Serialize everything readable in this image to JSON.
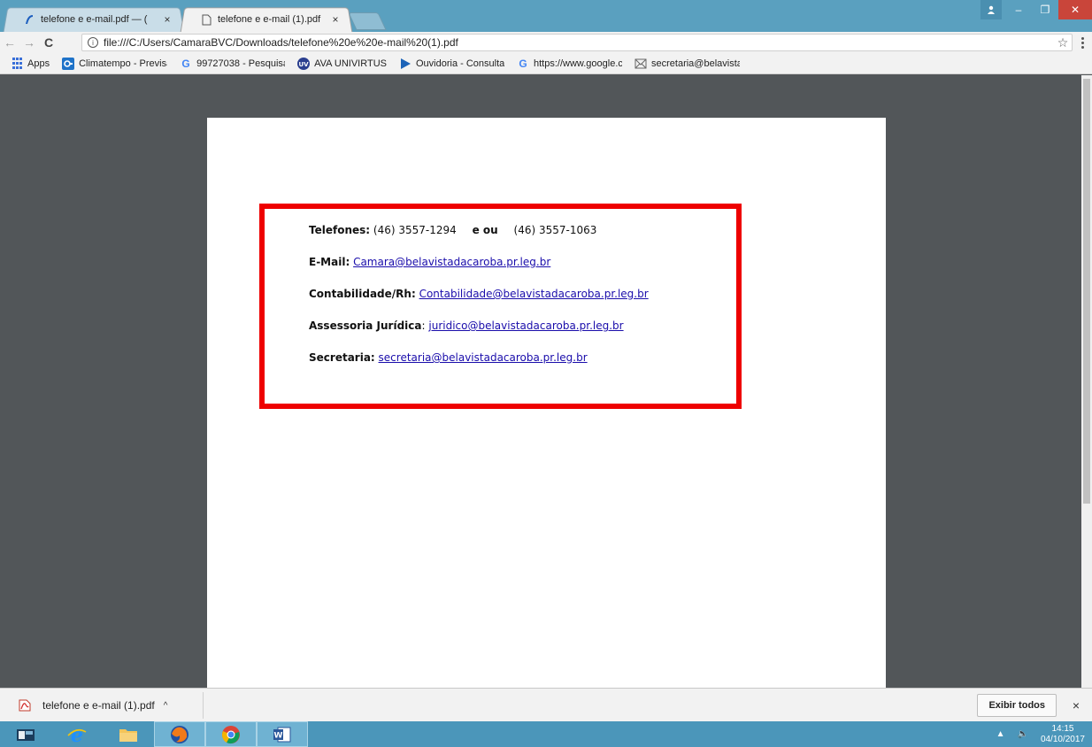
{
  "browser": {
    "tabs": [
      {
        "title": "telefone e e-mail.pdf — (",
        "close": "×",
        "active": false
      },
      {
        "title": "telefone e e-mail (1).pdf",
        "close": "×",
        "active": true
      }
    ],
    "window_controls": {
      "minimize": "–",
      "restore": "❐",
      "close": "✕"
    },
    "nav": {
      "back": "←",
      "forward": "→",
      "reload": "C"
    },
    "address": {
      "info": "i",
      "url": "file:///C:/Users/CamaraBVC/Downloads/telefone%20e%20e-mail%20(1).pdf",
      "star": "☆"
    },
    "bookmarks": [
      {
        "label": "Apps",
        "icon": "apps-grid-icon"
      },
      {
        "label": "Climatempo - Previsã",
        "icon": "climatempo-icon"
      },
      {
        "label": "99727038 - Pesquisa",
        "icon": "google-icon"
      },
      {
        "label": "AVA UNIVIRTUS",
        "icon": "uv-icon"
      },
      {
        "label": "Ouvidoria - Consultar",
        "icon": "arrow-play-icon"
      },
      {
        "label": "https://www.google.c",
        "icon": "google-icon"
      },
      {
        "label": "secretaria@belavistad",
        "icon": "mail-icon"
      }
    ]
  },
  "document": {
    "phones_label": "Telefones:",
    "phone_1": "(46) 3557-1294",
    "phone_connector": "e ou",
    "phone_2": "(46) 3557-1063",
    "email_label": "E-Mail:",
    "email": "Camara@belavistadacaroba.pr.leg.br",
    "accounting_label": "Contabilidade/Rh:",
    "accounting_email": "Contabilidade@belavistadacaroba.pr.leg.br",
    "legal_label": "Assessoria Jurídica",
    "legal_colon": ":",
    "legal_email": "juridico@belavistadacaroba.pr.leg.br",
    "secretary_label": "Secretaria:",
    "secretary_email": "secretaria@belavistadacaroba.pr.leg.br"
  },
  "download_bar": {
    "file_name": "telefone e e-mail (1).pdf",
    "chevron": "^",
    "show_all": "Exibir todos",
    "close": "×"
  },
  "taskbar": {
    "items": [
      "explorer-icon",
      "internet-explorer-icon",
      "file-explorer-icon",
      "firefox-icon",
      "chrome-icon",
      "word-icon"
    ],
    "clock_time": "14:15",
    "clock_date": "04/10/2017",
    "tray_arrow": "▲",
    "volume": "🔈"
  },
  "colors": {
    "highlight_border": "#ee0000",
    "link": "#1a0dab",
    "title_bar": "#5aa0bf",
    "viewer_bg": "#525659",
    "taskbar": "#4b96ba"
  }
}
